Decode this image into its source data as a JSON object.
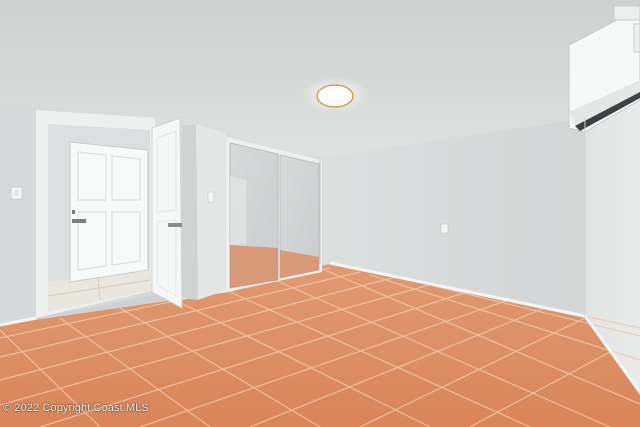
{
  "watermark": "© 2022 Copyright Coast MLS"
}
